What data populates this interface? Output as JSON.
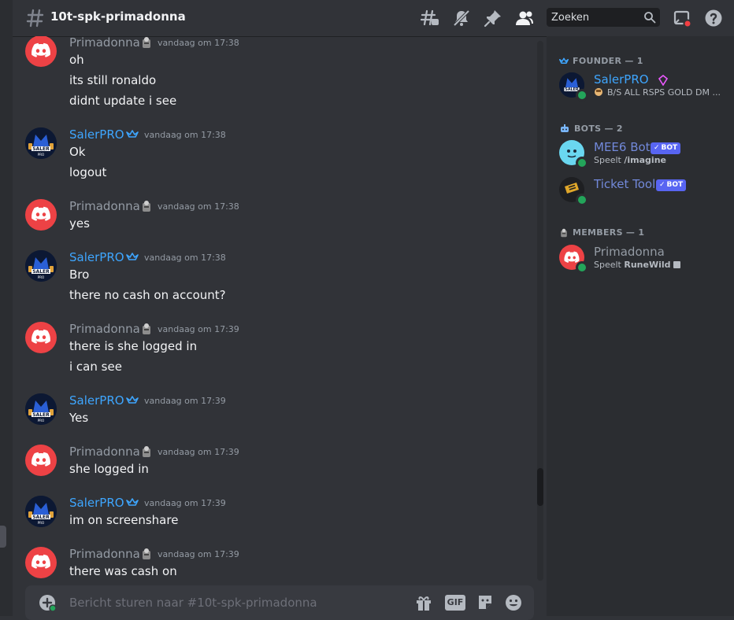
{
  "header": {
    "channel_name": "10t-spk-primadonna",
    "search_placeholder": "Zoeken",
    "icons": [
      "threads-icon",
      "mute-icon",
      "pin-icon",
      "members-icon",
      "search-icon",
      "inbox-icon",
      "help-icon"
    ]
  },
  "messages": [
    {
      "author": "Primadonna",
      "author_type": "prim",
      "timestamp": "vandaag om 17:38",
      "lines": [
        "oh",
        "its still ronaldo",
        "didnt update i see"
      ]
    },
    {
      "author": "SalerPRO",
      "author_type": "saler",
      "timestamp": "vandaag om 17:38",
      "lines": [
        "Ok",
        "logout"
      ]
    },
    {
      "author": "Primadonna",
      "author_type": "prim",
      "timestamp": "vandaag om 17:38",
      "lines": [
        "yes"
      ]
    },
    {
      "author": "SalerPRO",
      "author_type": "saler",
      "timestamp": "vandaag om 17:38",
      "lines": [
        "Bro",
        "there no cash on account?"
      ]
    },
    {
      "author": "Primadonna",
      "author_type": "prim",
      "timestamp": "vandaag om 17:39",
      "lines": [
        "there is she logged in",
        "i can see"
      ]
    },
    {
      "author": "SalerPRO",
      "author_type": "saler",
      "timestamp": "vandaag om 17:39",
      "lines": [
        "Yes"
      ]
    },
    {
      "author": "Primadonna",
      "author_type": "prim",
      "timestamp": "vandaag om 17:39",
      "lines": [
        "she logged in"
      ]
    },
    {
      "author": "SalerPRO",
      "author_type": "saler",
      "timestamp": "vandaag om 17:39",
      "lines": [
        "im on screenshare"
      ]
    },
    {
      "author": "Primadonna",
      "author_type": "prim",
      "timestamp": "vandaag om 17:39",
      "lines": [
        "there was cash on"
      ]
    }
  ],
  "composer": {
    "placeholder": "Bericht sturen naar #10t-spk-primadonna",
    "gif_label": "GIF"
  },
  "members": {
    "founder": {
      "label": "FOUNDER — 1",
      "name": "SalerPRO",
      "status_text": "B/S ALL RSPS GOLD DM ..."
    },
    "bots": {
      "label": "BOTS — 2",
      "items": [
        {
          "name": "MEE6 Bot",
          "tag": "BOT",
          "activity_prefix": "Speelt",
          "activity": "/imagine"
        },
        {
          "name": "Ticket Tool",
          "tag": "BOT"
        }
      ]
    },
    "members": {
      "label": "MEMBERS — 1",
      "name": "Primadonna",
      "activity_prefix": "Speelt",
      "activity": "RuneWild"
    }
  },
  "colors": {
    "accent": "#3ea6ff",
    "discord_red": "#ed4245",
    "online": "#23a55a",
    "bot_badge": "#5865f2",
    "bot_name": "#7289da"
  }
}
